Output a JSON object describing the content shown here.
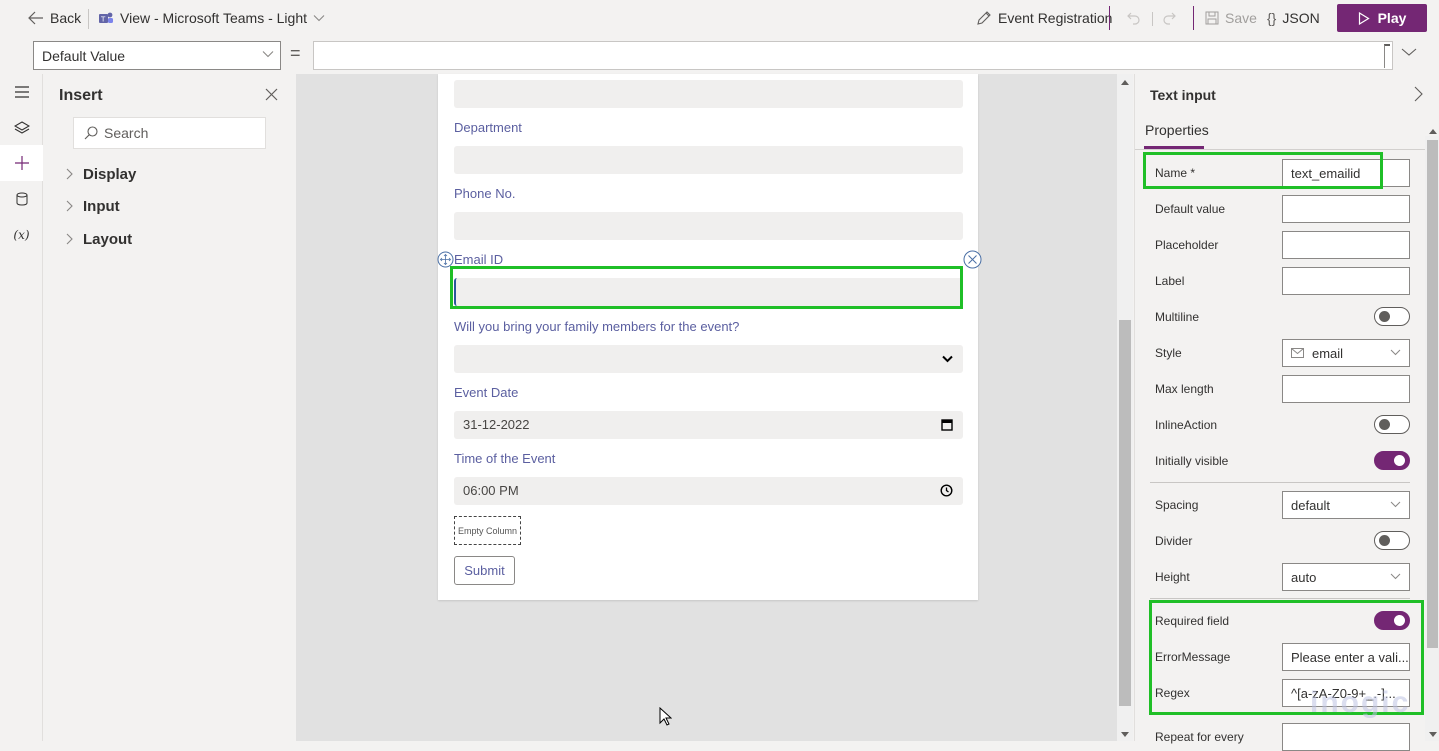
{
  "topbar": {
    "back_label": "Back",
    "view_label": "View - Microsoft Teams - Light",
    "app_name": "Event Registration",
    "save_label": "Save",
    "json_label": "JSON",
    "play_label": "Play"
  },
  "formula_bar": {
    "property": "Default Value",
    "equals": "=",
    "value": ""
  },
  "rail": {
    "items": [
      "menu",
      "layers",
      "insert",
      "data",
      "variables"
    ],
    "active": "insert"
  },
  "insert_panel": {
    "title": "Insert",
    "search_placeholder": "Search",
    "categories": [
      "Display",
      "Input",
      "Layout"
    ]
  },
  "form": {
    "fields": [
      {
        "label": "",
        "type": "text",
        "value": ""
      },
      {
        "label": "Department",
        "type": "text",
        "value": ""
      },
      {
        "label": "Phone No.",
        "type": "text",
        "value": ""
      },
      {
        "label": "Email ID",
        "type": "text",
        "value": "",
        "selected": true
      },
      {
        "label": "Will you bring your family members for the event?",
        "type": "select",
        "value": ""
      },
      {
        "label": "Event Date",
        "type": "date",
        "value": "31-12-2022"
      },
      {
        "label": "Time of the Event",
        "type": "time",
        "value": "06:00 PM"
      }
    ],
    "empty_column_label": "Empty Column",
    "submit_label": "Submit"
  },
  "properties_panel": {
    "title": "Text input",
    "tab": "Properties",
    "rows": [
      {
        "label": "Name *",
        "kind": "input",
        "value": "text_emailid"
      },
      {
        "label": "Default value",
        "kind": "input",
        "value": ""
      },
      {
        "label": "Placeholder",
        "kind": "input",
        "value": ""
      },
      {
        "label": "Label",
        "kind": "input",
        "value": ""
      },
      {
        "label": "Multiline",
        "kind": "toggle",
        "value": false
      },
      {
        "label": "Style",
        "kind": "select",
        "value": "email",
        "icon": "mail-icon"
      },
      {
        "label": "Max length",
        "kind": "input",
        "value": ""
      },
      {
        "label": "InlineAction",
        "kind": "toggle",
        "value": false
      },
      {
        "label": "Initially visible",
        "kind": "toggle",
        "value": true
      },
      {
        "label": "Spacing",
        "kind": "select",
        "value": "default"
      },
      {
        "label": "Divider",
        "kind": "toggle",
        "value": false
      },
      {
        "label": "Height",
        "kind": "select",
        "value": "auto"
      },
      {
        "label": "Required field",
        "kind": "toggle",
        "value": true
      },
      {
        "label": "ErrorMessage",
        "kind": "input",
        "value": "Please enter a vali..."
      },
      {
        "label": "Regex",
        "kind": "input",
        "value": "^[a-zA-Z0-9+_.-]..."
      },
      {
        "label": "Repeat for every",
        "kind": "input",
        "value": ""
      }
    ]
  },
  "watermark": "inogic",
  "colors": {
    "accent": "#742774",
    "highlight": "#1fbf27",
    "label": "#5b5fa0"
  }
}
